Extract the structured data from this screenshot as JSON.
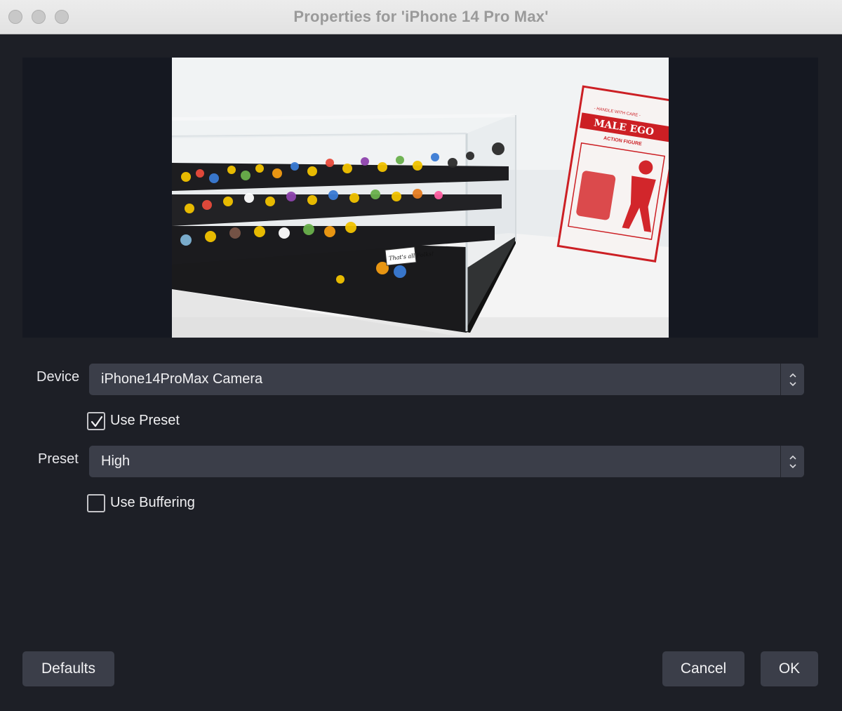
{
  "window": {
    "title": "Properties for 'iPhone 14 Pro Max'"
  },
  "preview": {
    "package_brand": "MALE EGO",
    "package_header": "- HANDLE WITH CARE -",
    "package_sub": "ACTION FIGURE",
    "sign_text": "That's all Folks!"
  },
  "form": {
    "device_label": "Device",
    "device_value": "iPhone14ProMax Camera",
    "use_preset_label": "Use Preset",
    "use_preset_checked": true,
    "preset_label": "Preset",
    "preset_value": "High",
    "use_buffering_label": "Use Buffering",
    "use_buffering_checked": false
  },
  "buttons": {
    "defaults": "Defaults",
    "cancel": "Cancel",
    "ok": "OK"
  },
  "colors": {
    "background": "#1d1f26",
    "control": "#3b3e49",
    "text": "#f0f0f2"
  }
}
